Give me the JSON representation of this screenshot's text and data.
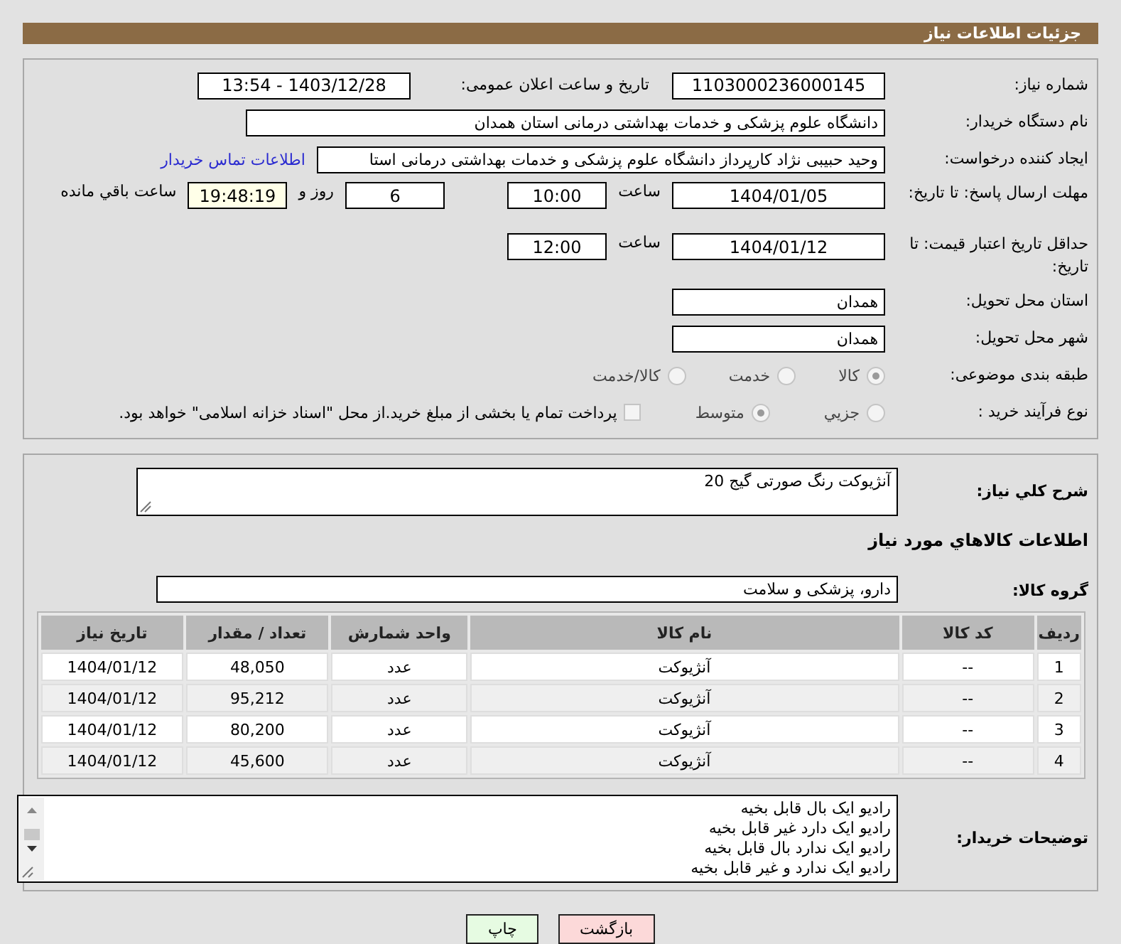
{
  "header": {
    "title": "جزئیات اطلاعات نیاز"
  },
  "info": {
    "need_number": {
      "label": "شماره نیاز:",
      "value": "1103000236000145"
    },
    "announce": {
      "label": "تاریخ و ساعت اعلان عمومی:",
      "value": "1403/12/28 - 13:54"
    },
    "buyer": {
      "label": "نام دستگاه خریدار:",
      "value": "دانشگاه علوم پزشکی و خدمات بهداشتی درمانی استان همدان"
    },
    "creator": {
      "label": "ایجاد کننده درخواست:",
      "value": "وحید حبیبی نژاد کارپرداز دانشگاه علوم پزشکی و خدمات بهداشتی درمانی استا",
      "link": "اطلاعات تماس خریدار"
    },
    "deadline": {
      "label": "مهلت ارسال پاسخ: تا تاریخ:",
      "date": "1404/01/05",
      "time_label": "ساعت",
      "time": "10:00",
      "days": "6",
      "days_label": "روز و",
      "remaining": "19:48:19",
      "remaining_label": "ساعت باقي مانده"
    },
    "validity": {
      "label": "حداقل تاریخ اعتبار قیمت: تا تاریخ:",
      "date": "1404/01/12",
      "time_label": "ساعت",
      "time": "12:00"
    },
    "province": {
      "label": "استان محل تحویل:",
      "value": "همدان"
    },
    "city": {
      "label": "شهر محل تحویل:",
      "value": "همدان"
    },
    "category": {
      "label": "طبقه بندی موضوعی:",
      "options": [
        {
          "label": "کالا",
          "selected": true
        },
        {
          "label": "خدمت",
          "selected": false
        },
        {
          "label": "کالا/خدمت",
          "selected": false
        }
      ]
    },
    "process": {
      "label": "نوع فرآیند خرید :",
      "options": [
        {
          "label": "جزیي",
          "selected": false
        },
        {
          "label": "متوسط",
          "selected": true
        }
      ],
      "treasury": {
        "label": "پرداخت تمام یا بخشی از مبلغ خرید.از محل \"اسناد خزانه اسلامی\" خواهد بود.",
        "checked": false
      }
    }
  },
  "details": {
    "description": {
      "label": "شرح کلي نياز:",
      "value": "آنژیوکت رنگ صورتی گیج 20"
    },
    "goods_heading": "اطلاعات کالاهاي مورد نياز",
    "group": {
      "label": "گروه کالا:",
      "value": "دارو، پزشکی و سلامت"
    },
    "table": {
      "columns": [
        "ردیف",
        "کد کالا",
        "نام کالا",
        "واحد شمارش",
        "تعداد / مقدار",
        "تاریخ نیاز"
      ],
      "rows": [
        [
          "1",
          "--",
          "آنژیوکت",
          "عدد",
          "48,050",
          "1404/01/12"
        ],
        [
          "2",
          "--",
          "آنژیوکت",
          "عدد",
          "95,212",
          "1404/01/12"
        ],
        [
          "3",
          "--",
          "آنژیوکت",
          "عدد",
          "80,200",
          "1404/01/12"
        ],
        [
          "4",
          "--",
          "آنژیوکت",
          "عدد",
          "45,600",
          "1404/01/12"
        ]
      ]
    },
    "notes": {
      "label": "توضیحات خریدار:",
      "lines": [
        "رادیو ایک بال قابل بخیه",
        "رادیو ایک دارد غیر قابل بخیه",
        "رادیو ایک ندارد بال قابل بخیه",
        "رادیو ایک ندارد و غیر قابل بخیه"
      ]
    }
  },
  "buttons": [
    {
      "kind": "back",
      "label": "بازگشت"
    },
    {
      "kind": "print",
      "label": "چاپ"
    }
  ]
}
